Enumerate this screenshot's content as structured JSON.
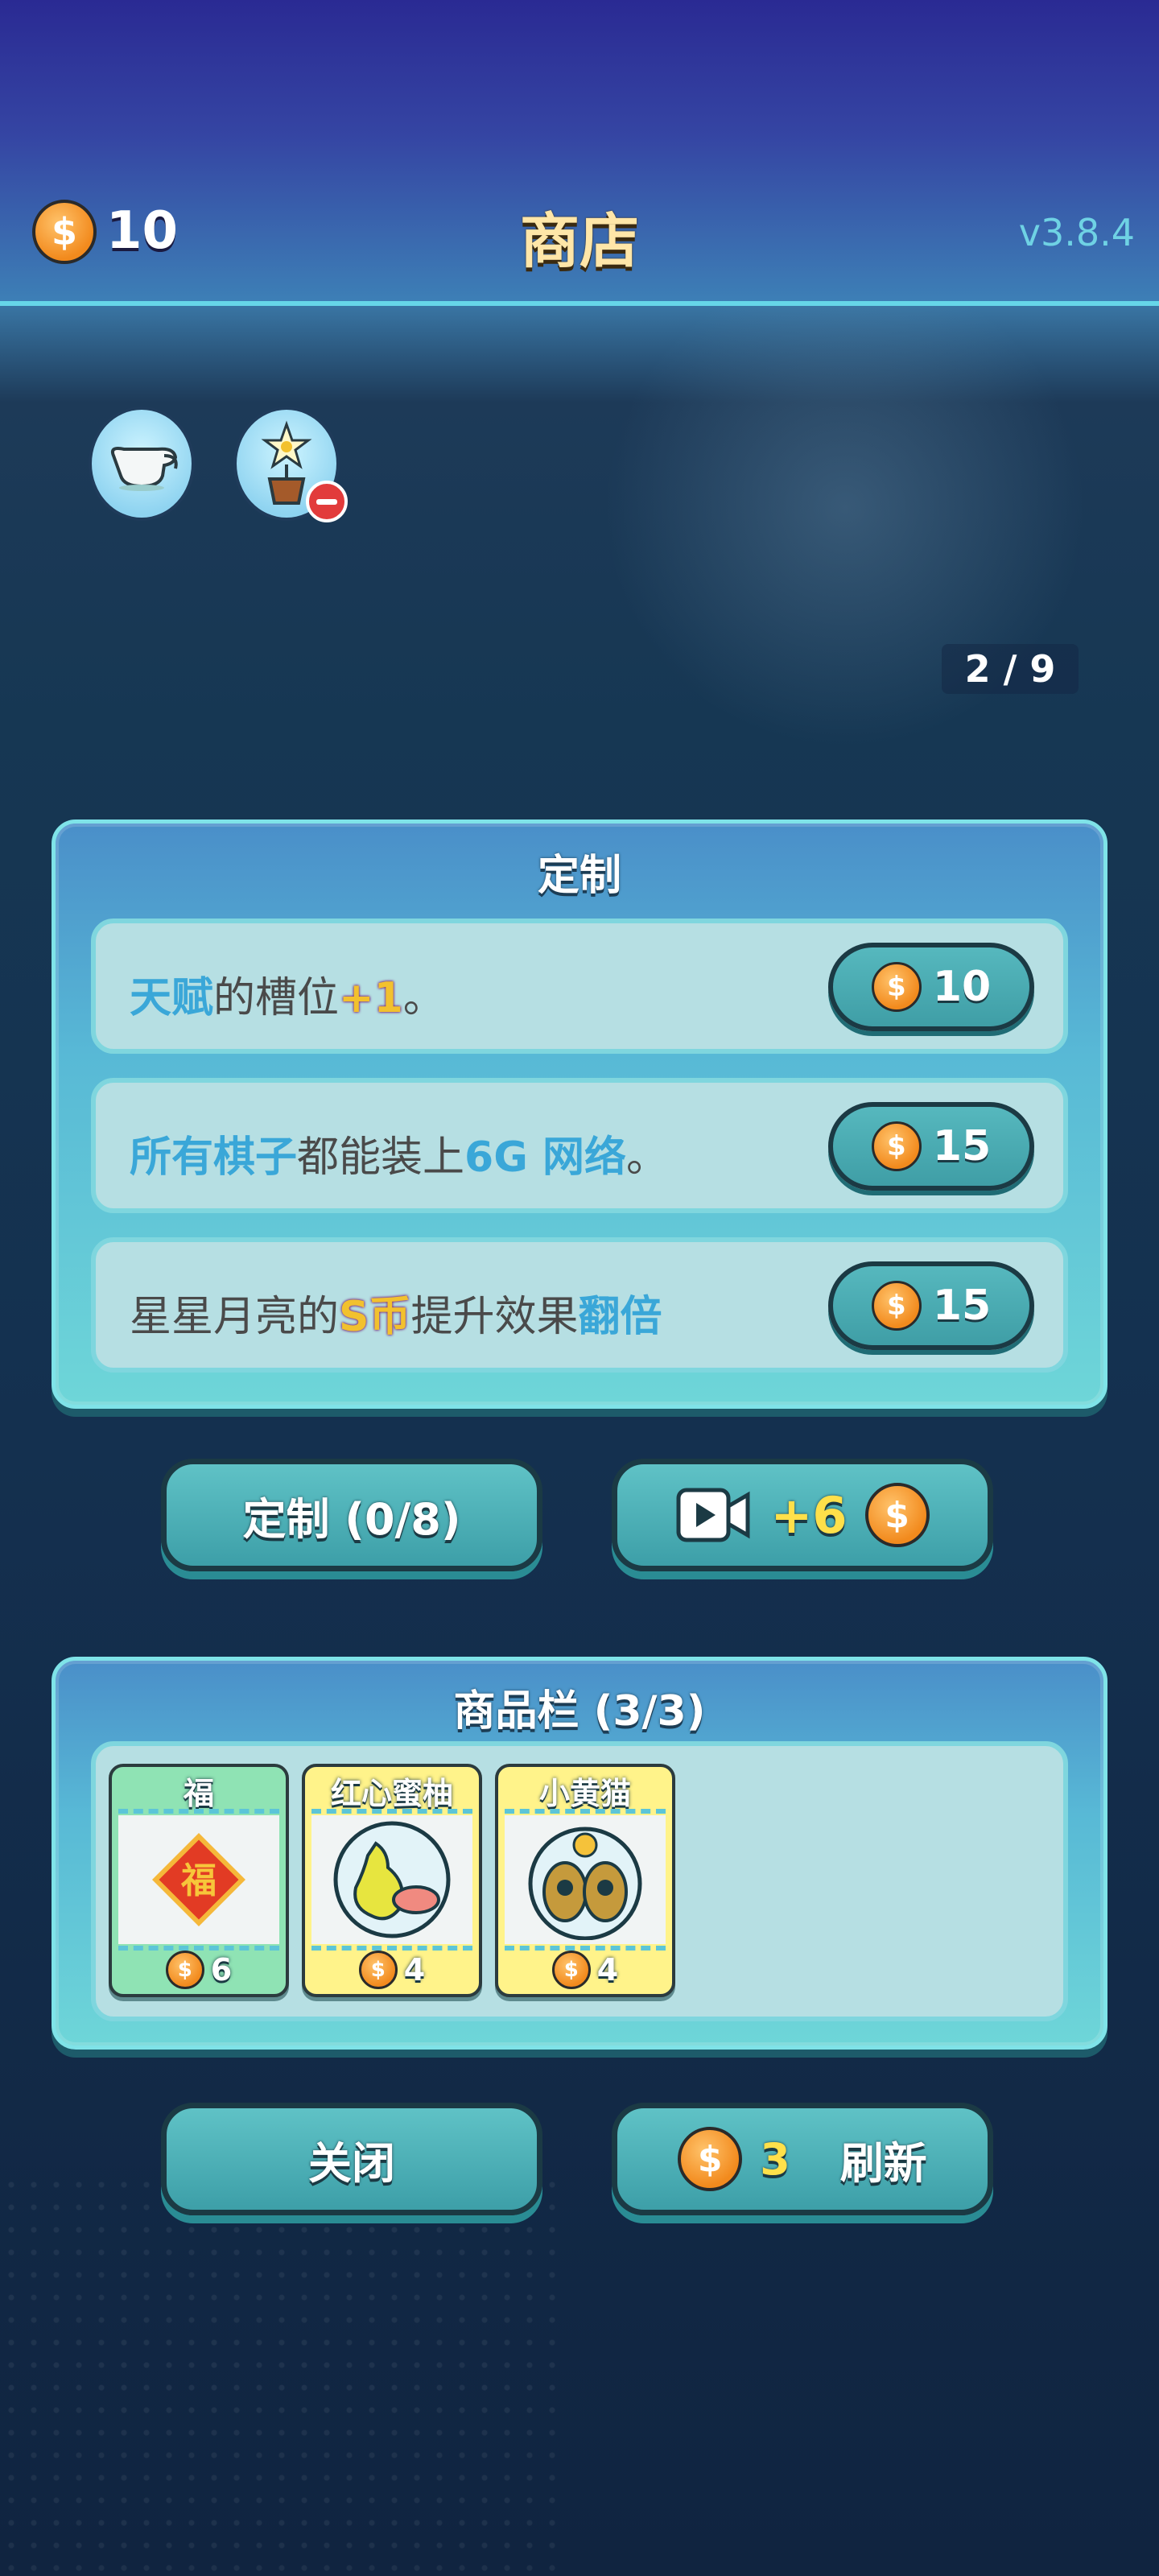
{
  "header": {
    "coins": "10",
    "title": "商店",
    "version": "v3.8.4"
  },
  "relics": {
    "items": [
      {
        "name": "milk-jug-icon"
      },
      {
        "name": "flower-pot-icon",
        "badge": "remove-badge-icon"
      }
    ]
  },
  "pager": {
    "text": "2 / 9"
  },
  "custom": {
    "title": "定制",
    "rows": [
      {
        "parts": [
          "天赋",
          "的槽位",
          "+1",
          "。"
        ],
        "price": "10"
      },
      {
        "parts": [
          "所有棋子",
          "都能装上",
          "6G 网络",
          "。"
        ],
        "price": "15"
      },
      {
        "parts": [
          "星星月亮的",
          "S币",
          "提升效果",
          "翻倍"
        ],
        "price": "15"
      }
    ]
  },
  "actions": {
    "custom_label": "定制 (0/8)",
    "video_reward": "+6"
  },
  "goods": {
    "title": "商品栏 (3/3)",
    "cards": [
      {
        "name": "福",
        "cost": "6",
        "pic_text": "福"
      },
      {
        "name": "红心蜜柚",
        "cost": "4"
      },
      {
        "name": "小黄猫",
        "cost": "4"
      }
    ]
  },
  "footer": {
    "close_label": "关闭",
    "refresh_cost": "3",
    "refresh_label": "刷新"
  },
  "colors": {
    "accent_blue": "#3aa7d8",
    "highlight_gold": "#f2c12e",
    "button_teal": "#4fb2b8",
    "coin_orange": "#f28a1d"
  }
}
